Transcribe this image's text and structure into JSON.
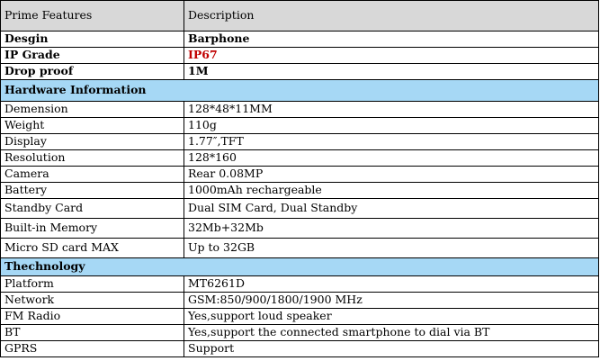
{
  "header": {
    "feature": "Prime  Features",
    "description": "Description"
  },
  "top_rows": [
    {
      "label": "Desgin",
      "value": "Barphone"
    },
    {
      "label": "IP Grade",
      "value": "IP67"
    },
    {
      "label": "Drop proof",
      "value": "1M"
    }
  ],
  "hardware": {
    "title": "Hardware Information",
    "rows": [
      {
        "label": "Demension",
        "value": "128*48*11MM"
      },
      {
        "label": "Weight",
        "value": "110g"
      },
      {
        "label": "Display",
        "value": "1.77″,TFT"
      },
      {
        "label": "Resolution",
        "value": "128*160"
      },
      {
        "label": "Camera",
        "value": "Rear 0.08MP"
      },
      {
        "label": "Battery",
        "value": "1000mAh  rechargeable"
      },
      {
        "label": "Standby Card",
        "value": "Dual SIM Card, Dual Standby"
      },
      {
        "label": "Built-in Memory",
        "value": "32Mb+32Mb"
      },
      {
        "label": "Micro SD card MAX",
        "value": "Up to 32GB"
      }
    ]
  },
  "technology": {
    "title": "Thechnology",
    "rows": [
      {
        "label": "Platform",
        "value": "MT6261D"
      },
      {
        "label": "Network",
        "value": "GSM:850/900/1800/1900 MHz"
      },
      {
        "label": "FM Radio",
        "value": "Yes,support loud speaker"
      },
      {
        "label": "BT",
        "value": "Yes,support the connected smartphone to dial via BT"
      },
      {
        "label": "GPRS",
        "value": "Support"
      }
    ]
  },
  "colors": {
    "section_bg": "#a6d8f5",
    "header_bg": "#d8d8d8",
    "highlight": "#c00000"
  }
}
